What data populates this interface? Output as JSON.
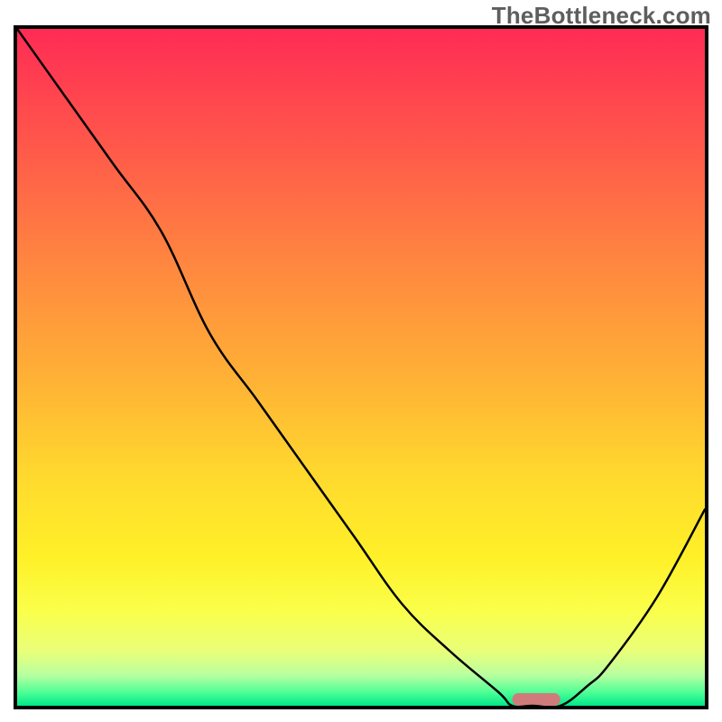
{
  "watermark": "TheBottleneck.com",
  "chart_data": {
    "type": "line",
    "title": "",
    "xlabel": "",
    "ylabel": "",
    "x": [
      0.0,
      0.07,
      0.14,
      0.21,
      0.28,
      0.35,
      0.42,
      0.49,
      0.56,
      0.63,
      0.7,
      0.72,
      0.75,
      0.79,
      0.83,
      0.86,
      0.93,
      1.0
    ],
    "values": [
      1.0,
      0.9,
      0.8,
      0.7,
      0.55,
      0.45,
      0.35,
      0.25,
      0.15,
      0.08,
      0.02,
      0.0,
      0.0,
      0.0,
      0.03,
      0.06,
      0.16,
      0.29
    ],
    "ylim": [
      0,
      1
    ],
    "xlim": [
      0,
      1
    ],
    "marker": {
      "x_start": 0.72,
      "x_end": 0.79,
      "y": 0.0
    },
    "gradient_bands": [
      [
        "#ff2b55",
        0.0
      ],
      [
        "#ff5a4a",
        0.18
      ],
      [
        "#ff8a3f",
        0.36
      ],
      [
        "#ffb235",
        0.52
      ],
      [
        "#ffd92e",
        0.66
      ],
      [
        "#fff028",
        0.78
      ],
      [
        "#faff4a",
        0.86
      ],
      [
        "#e9ff7a",
        0.92
      ],
      [
        "#b8ffa0",
        0.955
      ],
      [
        "#4fff96",
        0.98
      ],
      [
        "#00e889",
        1.0
      ]
    ]
  }
}
